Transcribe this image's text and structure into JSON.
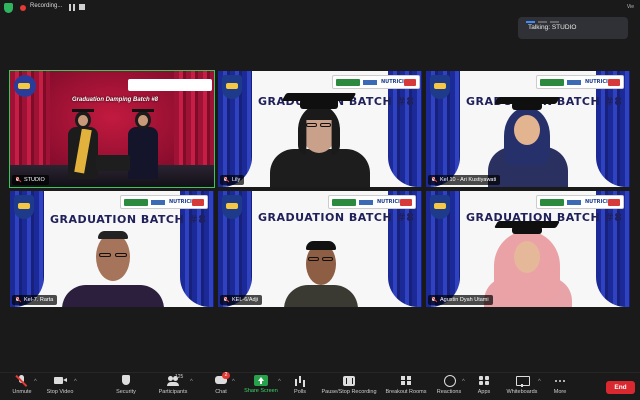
{
  "topbar": {
    "recording_label": "Recording...",
    "view_label": "Vie"
  },
  "talking": {
    "label": "Talking: STUDIO"
  },
  "tiles": [
    {
      "name": "STUDIO",
      "slide_title": "Graduation Damping Batch #8"
    },
    {
      "name": "Lily",
      "slide_title": "GRADUATION BATCH #8"
    },
    {
      "name": "Kel 10 - Ari Kustiyawati",
      "slide_title": "GRADUATION BATCH #8"
    },
    {
      "name": "Kel-7. Rarta",
      "slide_title": "GRADUATION BATCH #8"
    },
    {
      "name": "KEL-6/Adji",
      "slide_title": "GRADUATION BATCH #8"
    },
    {
      "name": "Agustin Dyah Utami",
      "slide_title": "GRADUATION BATCH #8"
    }
  ],
  "sponsor_text": "NUTRICIA",
  "toolbar": {
    "unmute": "Unmute",
    "stop_video": "Stop Video",
    "security": "Security",
    "participants": "Participants",
    "participants_count": "125",
    "chat": "Chat",
    "chat_badge": "2",
    "share_screen": "Share Screen",
    "polls": "Polls",
    "pause_recording": "Pause/Stop Recording",
    "breakout_rooms": "Breakout Rooms",
    "reactions": "Reactions",
    "apps": "Apps",
    "whiteboards": "Whiteboards",
    "more": "More",
    "end": "End"
  },
  "colors": {
    "active_speaker_border": "#38c75a",
    "end_button": "#d9282f",
    "share_screen": "#27a24a",
    "recording_dot": "#e53935"
  }
}
